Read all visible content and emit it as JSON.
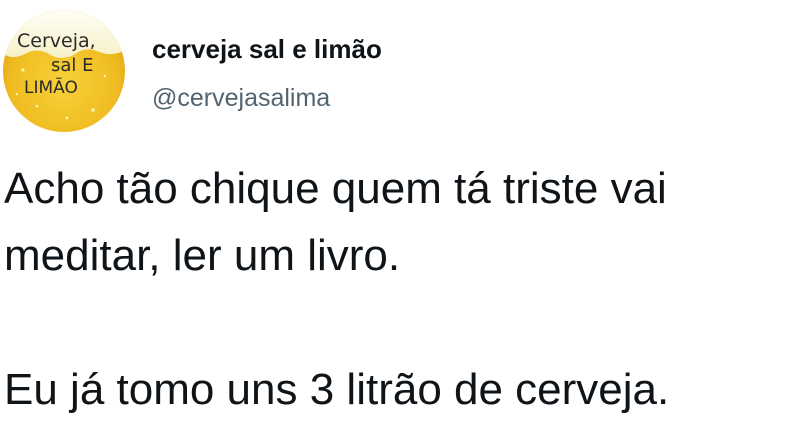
{
  "tweet": {
    "avatar": {
      "line1": "Cerveja,",
      "line2": "sal E",
      "line3": "LIMÃO",
      "colors": {
        "beer_gold": "#f2c227",
        "beer_dark": "#e0a515",
        "foam": "#fdfbe9",
        "text": "#2a2a2a"
      }
    },
    "display_name": "cerveja sal e limão",
    "handle": "@cervejasalima",
    "text": {
      "line1": "Acho tão chique quem tá triste vai",
      "line2": "meditar, ler um livro.",
      "line3": "Eu já tomo uns 3 litrão de cerveja."
    }
  }
}
